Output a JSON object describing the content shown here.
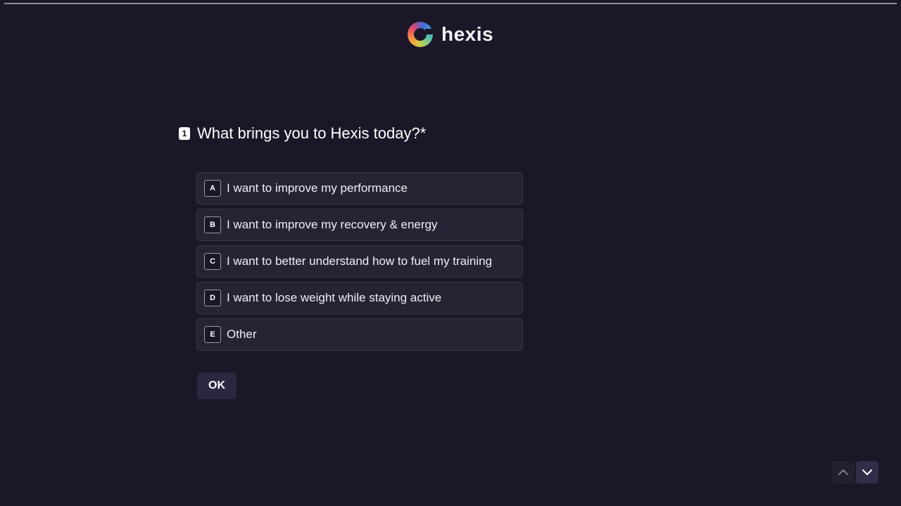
{
  "brand": {
    "name": "hexis",
    "logo_icon": "hexis-ring-logo-icon"
  },
  "progress": {
    "value": 0
  },
  "question": {
    "number": "1",
    "text": "What brings you to Hexis today?*"
  },
  "choices": [
    {
      "key": "A",
      "label": "I want to improve my performance"
    },
    {
      "key": "B",
      "label": "I want to improve my recovery & energy"
    },
    {
      "key": "C",
      "label": "I want to better understand how to fuel my training"
    },
    {
      "key": "D",
      "label": "I want to lose weight while staying active"
    },
    {
      "key": "E",
      "label": "Other"
    }
  ],
  "ok_button": {
    "label": "OK"
  },
  "navigation": {
    "up_icon": "chevron-up-icon",
    "down_icon": "chevron-down-icon"
  },
  "colors": {
    "background": "#1b1729",
    "choice_background": "#262335",
    "button_background": "#2a2840",
    "text": "#ffffff"
  }
}
